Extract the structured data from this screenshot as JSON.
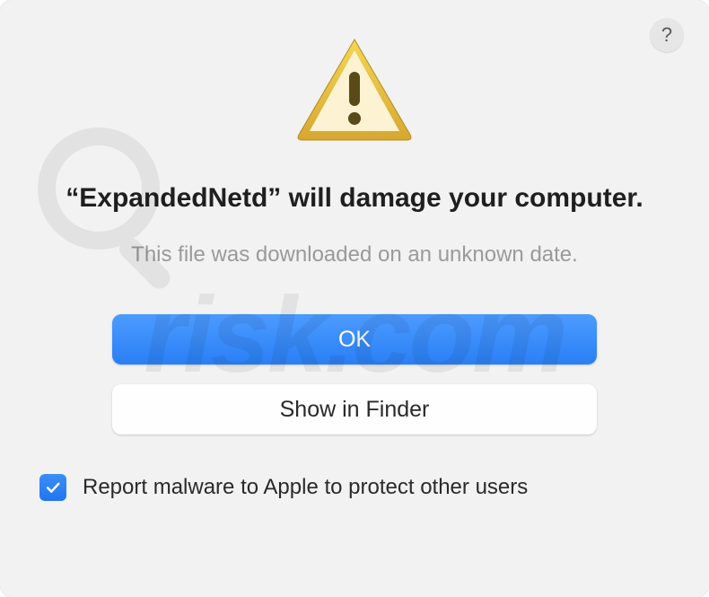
{
  "dialog": {
    "help_label": "?",
    "app_name": "ExpandedNetd",
    "title_before": "“",
    "title_after": "” will damage your computer.",
    "subtitle": "This file was downloaded on an unknown date.",
    "ok_label": "OK",
    "show_finder_label": "Show in Finder",
    "checkbox_label": "Report malware to Apple to protect other users",
    "checkbox_checked": true
  },
  "watermark": {
    "text": "risk.com"
  },
  "icons": {
    "warning": "warning-triangle-icon",
    "help": "help-icon",
    "checkmark": "checkmark-icon",
    "magnifier": "magnifier-icon"
  },
  "colors": {
    "primary_button": "#2a7ff5",
    "checkbox": "#2375f1",
    "dialog_bg": "#f2f2f2"
  }
}
